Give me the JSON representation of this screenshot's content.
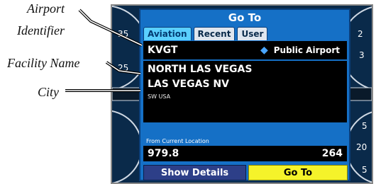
{
  "callouts": {
    "airport_identifier_line1": "Airport",
    "airport_identifier_line2": "Identifier",
    "facility_name": "Facility Name",
    "city": "City"
  },
  "dialog": {
    "title": "Go To",
    "tabs": [
      {
        "label": "Aviation",
        "active": true
      },
      {
        "label": "Recent",
        "active": false
      },
      {
        "label": "User",
        "active": false
      }
    ],
    "identifier": "KVGT",
    "type_icon": "airport-diamond-icon",
    "type_label": "Public Airport",
    "facility_name": "NORTH LAS VEGAS",
    "city": "LAS VEGAS NV",
    "region": "SW USA",
    "from_label": "From Current Location",
    "distance": "979.8",
    "bearing": "264",
    "buttons": {
      "show_details": "Show Details",
      "go_to": "Go To"
    }
  },
  "background_gauge_labels": {
    "left_top": "35",
    "left_mid": "25",
    "right_top": "2",
    "right_mid": "3",
    "right_low": "5",
    "right_20": "20",
    "right_bottom": "5"
  },
  "colors": {
    "dialog_blue": "#1570c6",
    "tab_active": "#5ad0ff",
    "goto_button": "#f5f32a",
    "details_button": "#2d3f88",
    "screen_bg": "#0a2a4a"
  }
}
